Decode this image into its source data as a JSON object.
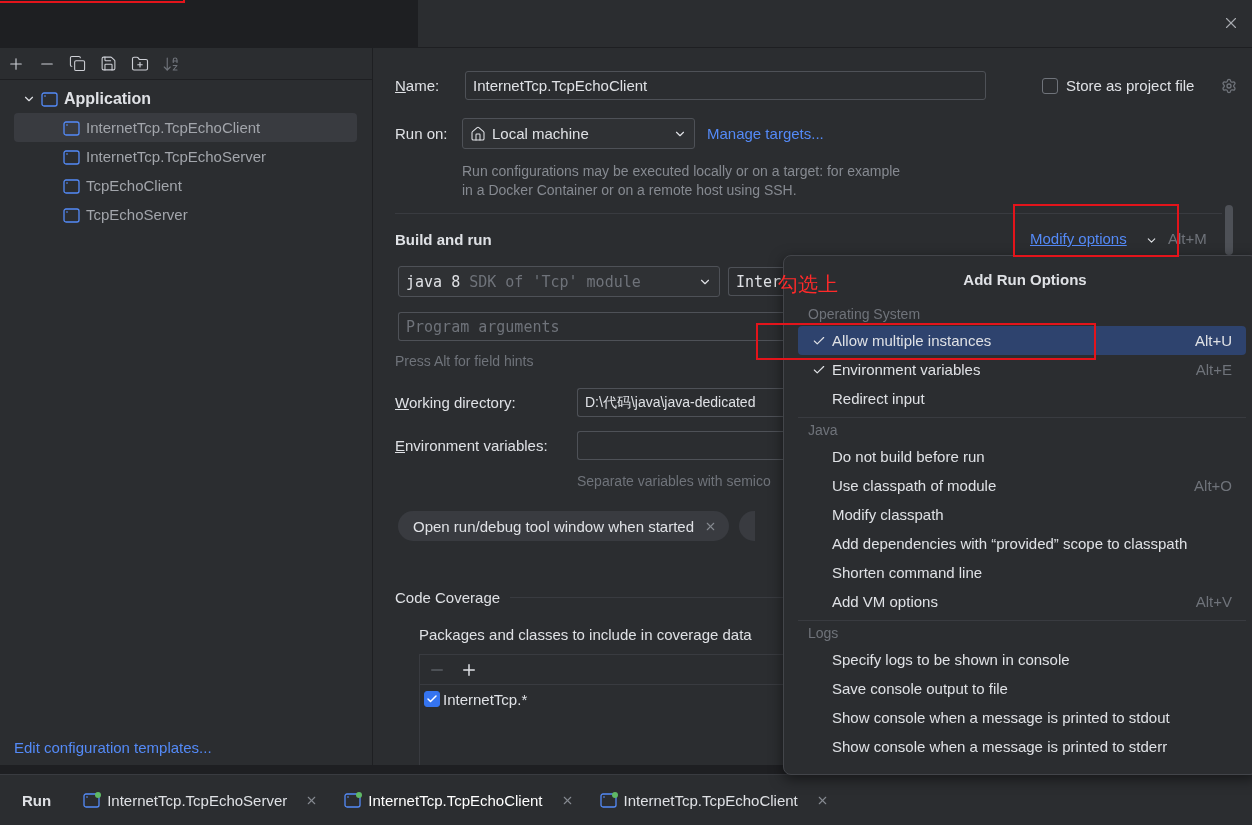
{
  "sidebar": {
    "tree": [
      {
        "label": "Application",
        "expanded": true,
        "children": [
          {
            "label": "InternetTcp.TcpEchoClient",
            "selected": true
          },
          {
            "label": "InternetTcp.TcpEchoServer",
            "selected": false
          },
          {
            "label": "TcpEchoClient",
            "selected": false
          },
          {
            "label": "TcpEchoServer",
            "selected": false
          }
        ]
      }
    ],
    "footer_link": "Edit configuration templates..."
  },
  "form": {
    "name": {
      "label": "Name:",
      "mnemonic": true,
      "value": "InternetTcp.TcpEchoClient"
    },
    "store_as_project_file": {
      "label": "Store as project file",
      "checked": false
    },
    "run_on": {
      "label": "Run on:",
      "mnemonic": false,
      "value": "Local machine",
      "link": "Manage targets..."
    },
    "run_on_note": [
      "Run configurations may be executed locally or on a target: for example",
      "in a Docker Container or on a remote host using SSH."
    ]
  },
  "build_and_run": {
    "title": "Build and run",
    "modify_options": {
      "label": "Modify options",
      "shortcut": "Alt+M"
    },
    "sdk": {
      "version": "java 8",
      "detail": "SDK of 'Tcp' module"
    },
    "main_class": "Inter",
    "program_arguments": {
      "placeholder": "Program arguments"
    },
    "hint": "Press Alt for field hints",
    "working_directory": {
      "label": "Working directory:",
      "mnemonic": true,
      "value": "D:\\代码\\java\\java-dedicated"
    },
    "environment_variables": {
      "label": "Environment variables:",
      "mnemonic": true
    },
    "env_hint": "Separate variables with semico",
    "chips": [
      {
        "kind": "full",
        "label": "Open run/debug tool window when started"
      },
      {
        "kind": "cut"
      }
    ]
  },
  "code_coverage": {
    "title": "Code Coverage",
    "caption": "Packages and classes to include in coverage data",
    "patterns": [
      {
        "label": "InternetTcp.*",
        "checked": true
      }
    ]
  },
  "popup": {
    "title": "Add Run Options",
    "sections": [
      {
        "header": "Operating System",
        "items": [
          {
            "label": "Allow multiple instances",
            "checked": true,
            "selected": true,
            "shortcut": "Alt+U"
          },
          {
            "label": "Environment variables",
            "checked": true,
            "selected": false,
            "shortcut": "Alt+E"
          },
          {
            "label": "Redirect input",
            "checked": false,
            "selected": false
          }
        ]
      },
      {
        "header": "Java",
        "items": [
          {
            "label": "Do not build before run",
            "checked": false,
            "selected": false
          },
          {
            "label": "Use classpath of module",
            "checked": false,
            "selected": false,
            "shortcut": "Alt+O"
          },
          {
            "label": "Modify classpath",
            "checked": false,
            "selected": false
          },
          {
            "label": "Add dependencies with “provided” scope to classpath",
            "checked": false,
            "selected": false
          },
          {
            "label": "Shorten command line",
            "checked": false,
            "selected": false
          },
          {
            "label": "Add VM options",
            "checked": false,
            "selected": false,
            "shortcut": "Alt+V"
          }
        ]
      },
      {
        "header": "Logs",
        "items": [
          {
            "label": "Specify logs to be shown in console",
            "checked": false,
            "selected": false
          },
          {
            "label": "Save console output to file",
            "checked": false,
            "selected": false
          },
          {
            "label": "Show console when a message is printed to stdout",
            "checked": false,
            "selected": false
          },
          {
            "label": "Show console when a message is printed to stderr",
            "checked": false,
            "selected": false
          }
        ]
      }
    ]
  },
  "annotation": {
    "note": "勾选上"
  },
  "run_bar": {
    "title": "Run",
    "tabs": [
      {
        "label": "InternetTcp.TcpEchoServer",
        "selected": false
      },
      {
        "label": "InternetTcp.TcpEchoClient",
        "selected": true
      },
      {
        "label": "InternetTcp.TcpEchoClient",
        "selected": false
      }
    ]
  }
}
